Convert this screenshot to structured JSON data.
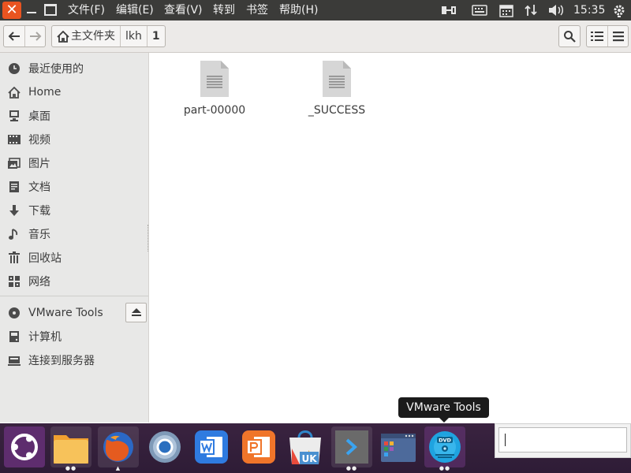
{
  "window": {
    "close_glyph": "✕"
  },
  "menubar": {
    "items": [
      {
        "label": "文件(F)"
      },
      {
        "label": "编辑(E)"
      },
      {
        "label": "查看(V)"
      },
      {
        "label": "转到"
      },
      {
        "label": "书签"
      },
      {
        "label": "帮助(H)"
      }
    ],
    "clock": "15:35"
  },
  "toolbar": {
    "breadcrumbs": [
      {
        "label": "主文件夹",
        "icon": "home-icon"
      },
      {
        "label": "lkh"
      },
      {
        "label": "1"
      }
    ]
  },
  "sidebar": {
    "places": [
      {
        "label": "最近使用的",
        "icon": "clock-icon"
      },
      {
        "label": "Home",
        "icon": "home-icon"
      },
      {
        "label": "桌面",
        "icon": "desktop-icon"
      },
      {
        "label": "视频",
        "icon": "film-icon"
      },
      {
        "label": "图片",
        "icon": "picture-icon"
      },
      {
        "label": "文档",
        "icon": "document-icon"
      },
      {
        "label": "下载",
        "icon": "download-icon"
      },
      {
        "label": "音乐",
        "icon": "music-icon"
      },
      {
        "label": "回收站",
        "icon": "trash-icon"
      },
      {
        "label": "网络",
        "icon": "network-icon"
      }
    ],
    "devices": [
      {
        "label": "VMware Tools",
        "icon": "disc-icon"
      },
      {
        "label": "计算机",
        "icon": "computer-icon"
      },
      {
        "label": "连接到服务器",
        "icon": "server-icon"
      }
    ]
  },
  "files": [
    {
      "name": "part-00000",
      "icon": "text-file-icon"
    },
    {
      "name": "_SUCCESS",
      "icon": "text-file-icon"
    }
  ],
  "tooltip": {
    "text": "VMware Tools"
  },
  "dock": {
    "items": [
      {
        "name": "ubuntu-dash",
        "running": false
      },
      {
        "name": "files",
        "running": true
      },
      {
        "name": "firefox",
        "running": true
      },
      {
        "name": "chromium",
        "running": false
      },
      {
        "name": "wps-writer",
        "running": false
      },
      {
        "name": "wps-presentation",
        "running": false
      },
      {
        "name": "ubuntu-kylin-software",
        "badge": "UK",
        "running": false
      },
      {
        "name": "terminal",
        "running": true
      },
      {
        "name": "workspace-switcher",
        "running": false
      },
      {
        "name": "vmware-tools-dvd",
        "badge": "DVD",
        "running": true
      }
    ]
  },
  "colors": {
    "accent": "#e95420",
    "panel": "#3b3b39",
    "dock": "#33203b",
    "sidebar": "#e8e8e7"
  }
}
